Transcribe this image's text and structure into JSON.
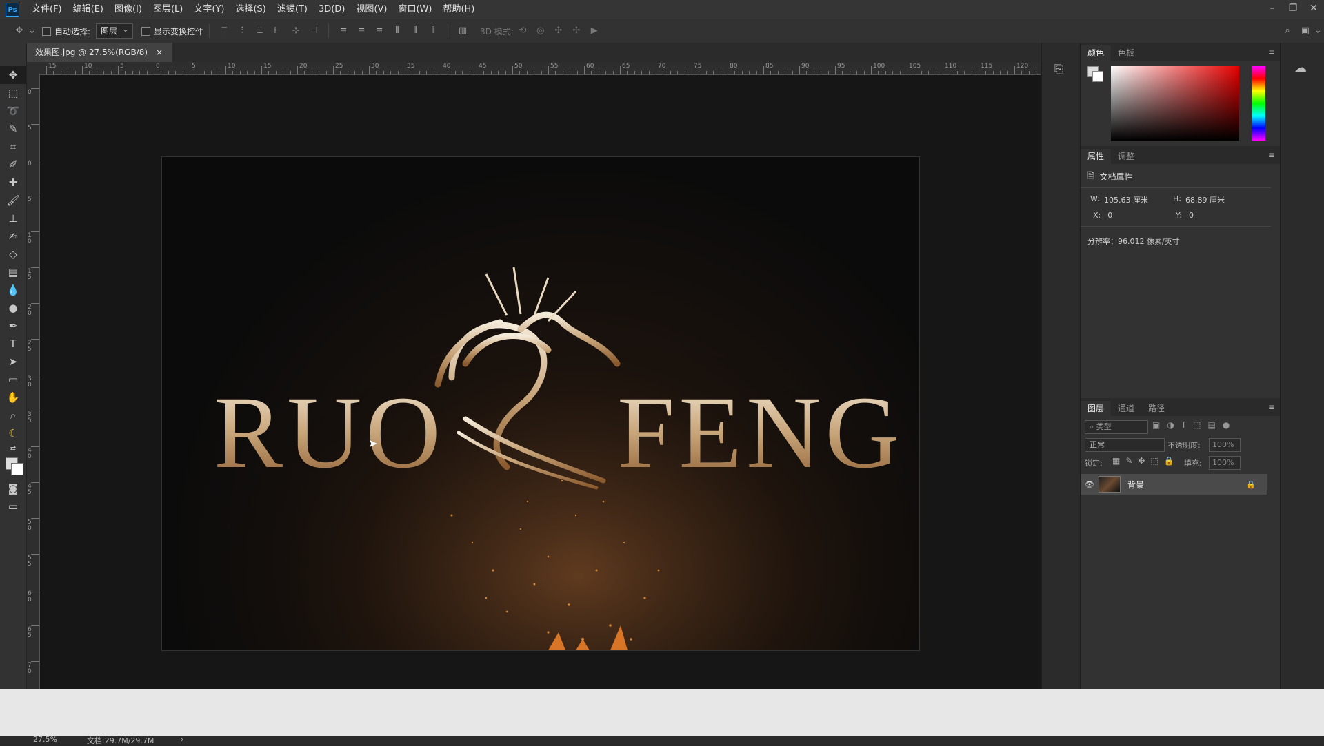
{
  "app": {
    "logo": "Ps"
  },
  "menu": [
    "文件(F)",
    "编辑(E)",
    "图像(I)",
    "图层(L)",
    "文字(Y)",
    "选择(S)",
    "滤镜(T)",
    "3D(D)",
    "视图(V)",
    "窗口(W)",
    "帮助(H)"
  ],
  "window_controls": [
    "–",
    "❐",
    "✕"
  ],
  "options": {
    "auto_select_label": "自动选择:",
    "auto_select_value": "图层",
    "show_transform_label": "显示变换控件",
    "mode3d_label": "3D 模式:"
  },
  "tools": [
    "move-icon",
    "marquee-icon",
    "lasso-icon",
    "quick-select-icon",
    "crop-icon",
    "eyedropper-icon",
    "healing-icon",
    "brush-icon",
    "stamp-icon",
    "history-brush-icon",
    "eraser-icon",
    "gradient-icon",
    "blur-icon",
    "dodge-icon",
    "pen-icon",
    "type-icon",
    "path-select-icon",
    "rectangle-icon",
    "hand-icon",
    "zoom-icon",
    "banana-icon"
  ],
  "document": {
    "tab_title": "效果图.jpg @ 27.5%(RGB/8)",
    "close": "×"
  },
  "ruler": {
    "h_labels": [
      "15",
      "10",
      "5",
      "0",
      "5",
      "10",
      "15",
      "20",
      "25",
      "30",
      "35",
      "40",
      "45",
      "50",
      "55",
      "60",
      "65",
      "70",
      "75",
      "80",
      "85",
      "90",
      "95",
      "100",
      "105",
      "110",
      "115",
      "120"
    ],
    "v_labels": [
      "0",
      "5",
      "0",
      "5",
      "1 0",
      "1 5",
      "2 0",
      "2 5",
      "3 0",
      "3 5",
      "4 0",
      "4 5",
      "5 0",
      "5 5",
      "6 0",
      "6 5",
      "7 0"
    ]
  },
  "image": {
    "text_left": "RUO",
    "text_right": "FENG"
  },
  "color_panel": {
    "tabs": [
      "颜色",
      "色板"
    ]
  },
  "properties_panel": {
    "tabs": [
      "属性",
      "调整"
    ],
    "doc_label": "文档属性",
    "w_label": "W:",
    "w_value": "105.63 厘米",
    "h_label": "H:",
    "h_value": "68.89 厘米",
    "x_label": "X:",
    "x_value": "0",
    "y_label": "Y:",
    "y_value": "0",
    "resolution": "分辨率：96.012 像素/英寸"
  },
  "layers_panel": {
    "tabs": [
      "图层",
      "通道",
      "路径"
    ],
    "filter_kind": "类型",
    "blend_mode": "正常",
    "opacity_label": "不透明度:",
    "opacity_value": "100%",
    "lock_label": "锁定:",
    "fill_label": "填充:",
    "fill_value": "100%",
    "layers": [
      {
        "name": "背景"
      }
    ]
  },
  "status": {
    "zoom": "27.5%",
    "doc_size": "文档:29.7M/29.7M"
  }
}
